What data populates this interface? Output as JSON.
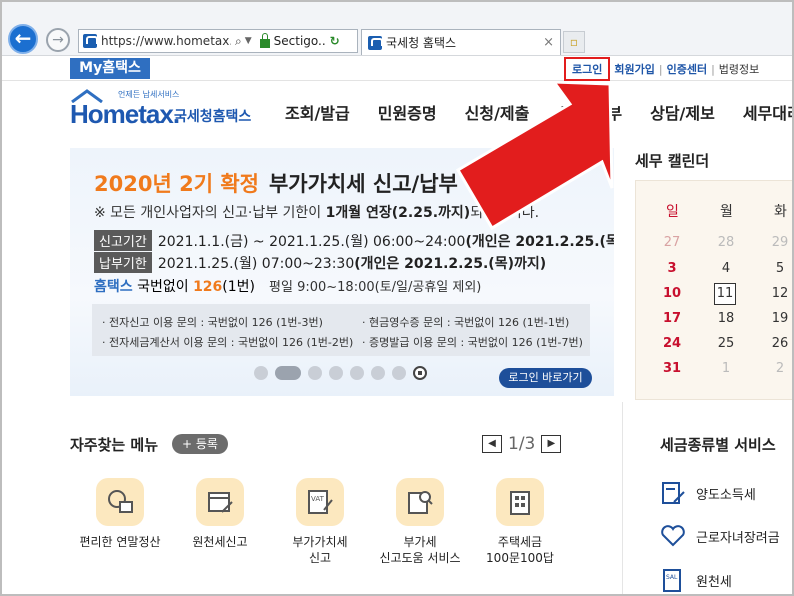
{
  "browser": {
    "url": "https://www.hometax...",
    "cert": "Sectigo...",
    "tab_title": "국세청 홈택스",
    "tab_close": "×",
    "back_glyph": "←",
    "forward_glyph": "→"
  },
  "topbar": {
    "my_hometax": "My홈택스",
    "links": [
      "로그인",
      "회원가입",
      "인증센터",
      "법령정보"
    ],
    "highlighted": "로그인"
  },
  "logo": {
    "tagline": "언제든 납세서비스",
    "name": "Hometax.",
    "sub": "국세청홈택스"
  },
  "gnb": [
    "조회/발급",
    "민원증명",
    "신청/제출",
    "신고/납부",
    "상담/제보",
    "세무대리"
  ],
  "banner": {
    "title_year": "2020년 2기 확정",
    "title_desc": "부가가치세 신고/납부",
    "note_pre": "※ 모든 개인사업자의 신고·납부 기한이 ",
    "note_bold": "1개월 연장(2.25.까지)",
    "note_post": "되었습니다.",
    "filing_label": "신고기간",
    "filing_text": "2021.1.1.(금) ~ 2021.1.25.(월) 06:00~24:00 ",
    "filing_bold": "(개인은 2021.2.25.(목)까지)",
    "payment_label": "납부기한",
    "payment_text": "2021.1.25.(월) 07:00~23:30 ",
    "payment_bold": "(개인은 2021.2.25.(목)까지)",
    "phone_brand": "홈택스",
    "phone_pre": " 국번없이 ",
    "phone_num": "126",
    "phone_post": "(1번)",
    "phone_hours": "평일 9:00~18:00(토/일/공휴일 제외)",
    "inquiries": [
      "· 전자신고 이용 문의 : 국번없이 126 (1번-3번)",
      "· 현금영수증 문의 : 국번없이 126 (1번-1번)",
      "· 전자세금계산서 이용 문의 : 국번없이 126 (1번-2번)",
      "· 증명발급 이용 문의 : 국번없이 126 (1번-7번)"
    ],
    "login_shortcut": "로그인 바로가기"
  },
  "calendar": {
    "title": "세무 캘린더",
    "headers": [
      "일",
      "월",
      "화"
    ],
    "rows": [
      [
        "27",
        "28",
        "29"
      ],
      [
        "3",
        "4",
        "5"
      ],
      [
        "10",
        "11",
        "12"
      ],
      [
        "17",
        "18",
        "19"
      ],
      [
        "24",
        "25",
        "26"
      ],
      [
        "31",
        "1",
        "2"
      ]
    ],
    "today": "11"
  },
  "favorites": {
    "title": "자주찾는 메뉴",
    "add_label": "+ 등록",
    "page": "1/3",
    "items": [
      {
        "label": "편리한 연말정산",
        "label2": ""
      },
      {
        "label": "원천세신고",
        "label2": ""
      },
      {
        "label": "부가가치세",
        "label2": "신고"
      },
      {
        "label": "부가세",
        "label2": "신고도움 서비스"
      },
      {
        "label": "주택세금",
        "label2": "100문100답"
      }
    ]
  },
  "tax_services": {
    "title": "세금종류별 서비스",
    "items": [
      "양도소득세",
      "근로자녀장려금",
      "원천세"
    ]
  },
  "colors": {
    "accent": "#2f6fc1",
    "orange": "#f07a1c",
    "red": "#e21d1d",
    "sunday": "#c8102e"
  }
}
